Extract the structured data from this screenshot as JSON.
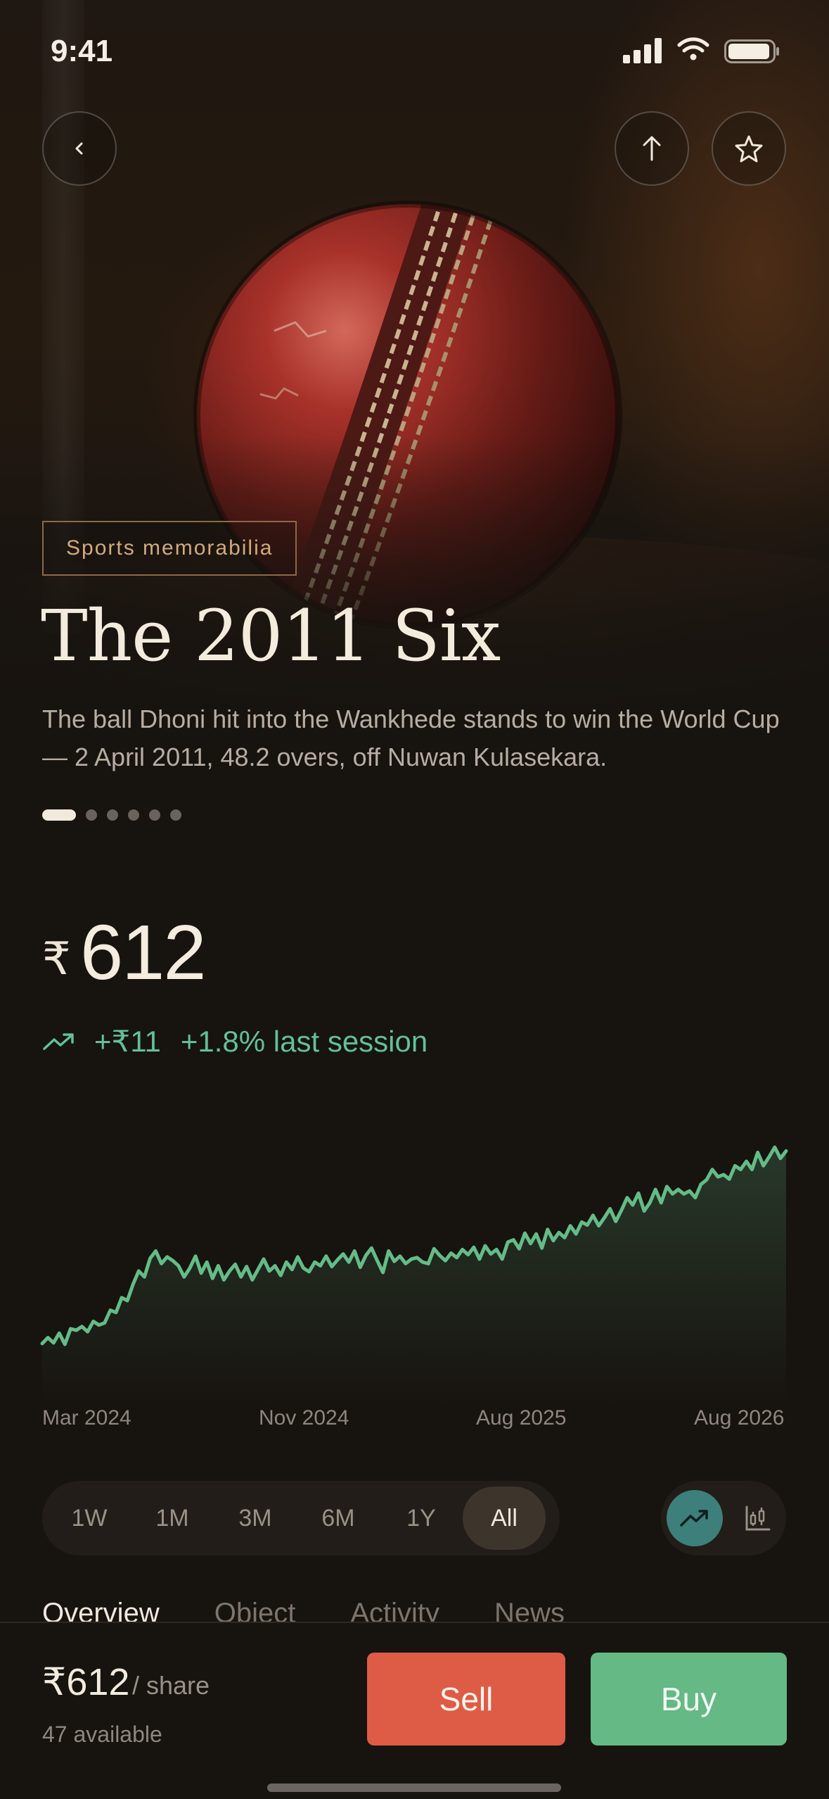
{
  "status_bar": {
    "time": "9:41"
  },
  "hero": {
    "category": "Sports memorabilia",
    "title": "The 2011 Six",
    "description": "The ball Dhoni hit into the Wankhede stands to win the World Cup — 2 April 2011, 48.2 overs, off Nuwan Kulasekara.",
    "image_count": 6,
    "active_image_index": 0,
    "icons": {
      "back": "chevron-left-icon",
      "share": "share-up-arrow-icon",
      "favorite": "star-icon"
    }
  },
  "price": {
    "currency": "₹",
    "value": "612",
    "change_abs": "+₹11",
    "change_pct": "+1.8% last session",
    "trend_icon": "trending-up-icon"
  },
  "chart_data": {
    "type": "area",
    "title": "",
    "xlabel": "",
    "ylabel": "",
    "x_tick_labels": [
      "Mar 2024",
      "Nov 2024",
      "Aug 2025",
      "Aug 2026"
    ],
    "x_range": [
      "Mar 2024",
      "Aug 2026"
    ],
    "series": [
      {
        "values": [
          400,
          408,
          401,
          414,
          399,
          420,
          418,
          423,
          416,
          430,
          425,
          428,
          445,
          442,
          462,
          458,
          480,
          498,
          490,
          515,
          525,
          508,
          517,
          512,
          505,
          490,
          502,
          518,
          495,
          510,
          488,
          505,
          486,
          498,
          507,
          490,
          504,
          486,
          500,
          514,
          498,
          505,
          492,
          510,
          500,
          517,
          502,
          497,
          510,
          505,
          518,
          504,
          513,
          521,
          510,
          525,
          503,
          519,
          529,
          512,
          496,
          525,
          511,
          518,
          508,
          514,
          516,
          510,
          508,
          528,
          519,
          512,
          522,
          516,
          527,
          520,
          530,
          514,
          532,
          521,
          527,
          514,
          537,
          540,
          528,
          549,
          535,
          548,
          529,
          554,
          539,
          550,
          543,
          559,
          548,
          564,
          560,
          573,
          559,
          570,
          582,
          565,
          580,
          597,
          587,
          603,
          579,
          590,
          608,
          590,
          612,
          602,
          608,
          602,
          606,
          597,
          615,
          621,
          635,
          625,
          628,
          622,
          640,
          635,
          646,
          635,
          658,
          640,
          652,
          665,
          650,
          660
        ]
      }
    ],
    "color": "#64bc87",
    "grid": false,
    "legend": "none"
  },
  "range_selector": {
    "options": [
      "1W",
      "1M",
      "3M",
      "6M",
      "1Y",
      "All"
    ],
    "selected": "All"
  },
  "chart_type_toggle": {
    "options": [
      "line-chart-icon",
      "candlestick-chart-icon"
    ],
    "selected": "line-chart-icon"
  },
  "tabs": [
    "Overview",
    "Object",
    "Activity",
    "News"
  ],
  "active_tab": "Overview",
  "bottom_bar": {
    "price": "₹612",
    "unit": "/ share",
    "available": "47 available",
    "sell_label": "Sell",
    "buy_label": "Buy"
  },
  "colors": {
    "up": "#62c09a",
    "sell": "#de5c46",
    "buy": "#64b984",
    "accent_tag": "#d2ab7a"
  }
}
